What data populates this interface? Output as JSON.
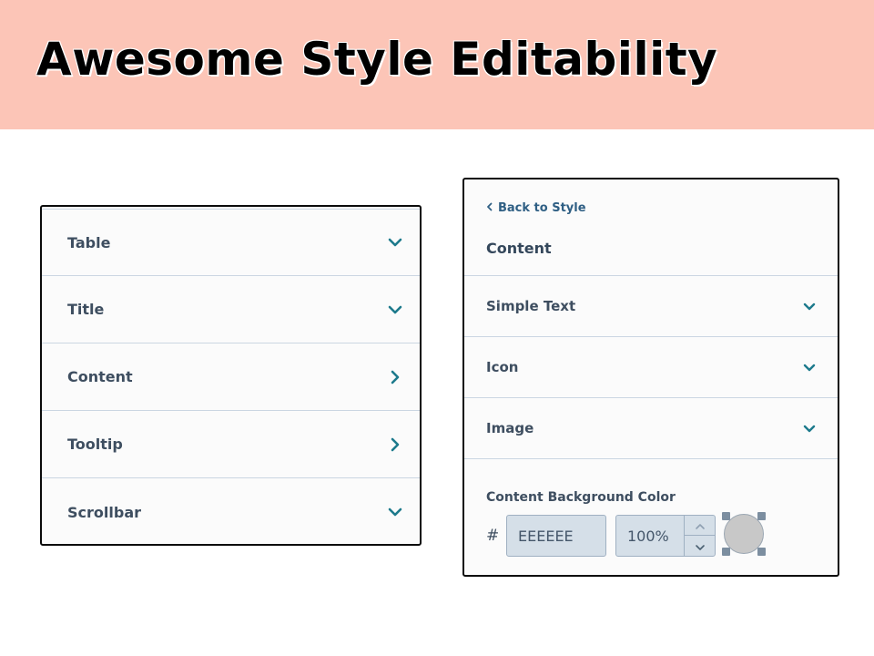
{
  "banner": {
    "title": "Awesome Style Editability",
    "color": "#fcc5b7"
  },
  "left_panel": {
    "items": [
      {
        "label": "Table",
        "icon": "chevron-down-icon"
      },
      {
        "label": "Title",
        "icon": "chevron-down-icon"
      },
      {
        "label": "Content",
        "icon": "chevron-right-icon"
      },
      {
        "label": "Tooltip",
        "icon": "chevron-right-icon"
      },
      {
        "label": "Scrollbar",
        "icon": "chevron-down-icon"
      }
    ]
  },
  "right_panel": {
    "back_link": "Back to Style",
    "title": "Content",
    "items": [
      {
        "label": "Simple Text",
        "icon": "chevron-down-icon"
      },
      {
        "label": "Icon",
        "icon": "chevron-down-icon"
      },
      {
        "label": "Image",
        "icon": "chevron-down-icon"
      }
    ],
    "background_color": {
      "label": "Content Background Color",
      "hash": "#",
      "hex_value": "EEEEEE",
      "opacity_value": "100%",
      "swatch_color": "#c8c8c8"
    }
  },
  "colors": {
    "accent": "#1d7a8c",
    "text": "#3e4e60",
    "divider": "#cbd6e2",
    "input_bg": "#d5dfe8"
  }
}
